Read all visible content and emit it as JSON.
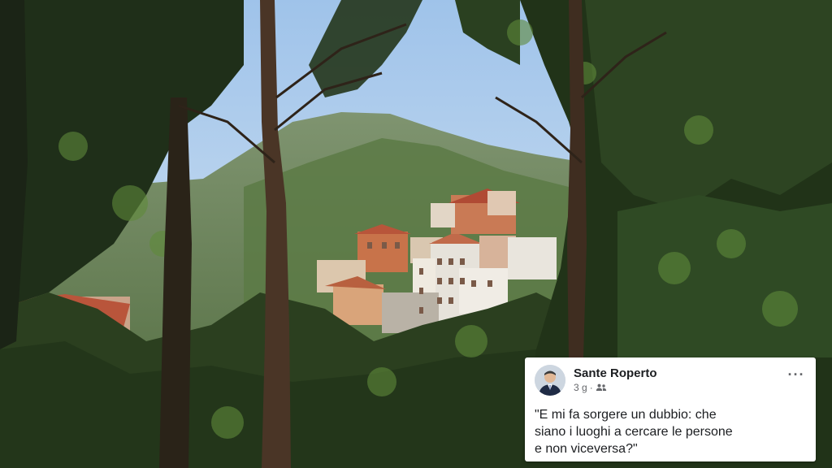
{
  "post": {
    "author": "Sante Roperto",
    "time": "3 g",
    "separator": "·",
    "privacy_icon": "friends-icon",
    "more_icon": "more-options-icon",
    "more_label": "···",
    "text": "\"E mi fa sorgere un dubbio: che\nsiano i luoghi a cercare le persone\ne non viceversa?\""
  },
  "colors": {
    "card_bg": "#ffffff",
    "author_text": "#1c1e21",
    "meta_text": "#65676b"
  }
}
